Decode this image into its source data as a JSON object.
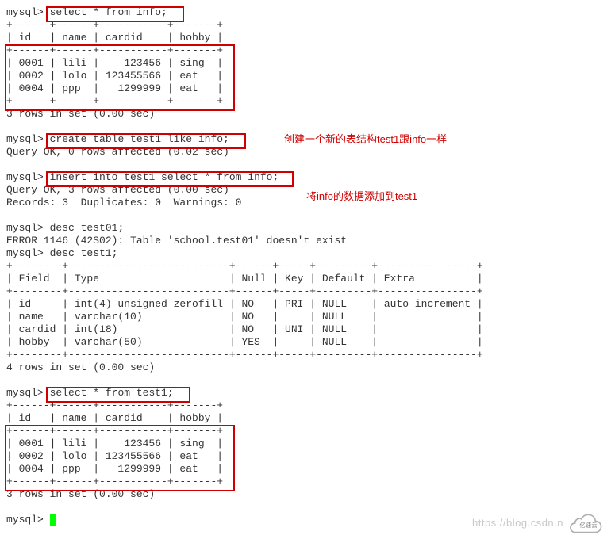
{
  "terminal": {
    "prompt": "mysql>",
    "stmt_select_info": "select * from info;",
    "hdr_sep": "+------+------+-----------+-------+",
    "hdr_cols": "| id   | name | cardid    | hobby |",
    "hdr_sep2": "+------+------+-----------+-------+",
    "row1": "| 0001 | lili |    123456 | sing  |",
    "row2": "| 0002 | lolo | 123455566 | eat   |",
    "row3": "| 0004 | ppp  |   1299999 | eat   |",
    "hdr_sep3": "+------+------+-----------+-------+",
    "rows3": "3 rows in set (0.00 sec)",
    "blank": "",
    "stmt_create": "create table test1 like info;",
    "create_ok": "Query OK, 0 rows affected (0.02 sec)",
    "stmt_insert": "insert into test1 select * from info;",
    "insert_ok": "Query OK, 3 rows affected (0.00 sec)",
    "records": "Records: 3  Duplicates: 0  Warnings: 0",
    "stmt_desc01": "desc test01;",
    "err01": "ERROR 1146 (42S02): Table 'school.test01' doesn't exist",
    "stmt_desc1": "desc test1;",
    "dsep": "+--------+--------------------------+------+-----+---------+----------------+",
    "dhdr": "| Field  | Type                     | Null | Key | Default | Extra          |",
    "dsep2": "+--------+--------------------------+------+-----+---------+----------------+",
    "d1": "| id     | int(4) unsigned zerofill | NO   | PRI | NULL    | auto_increment |",
    "d2": "| name   | varchar(10)              | NO   |     | NULL    |                |",
    "d3": "| cardid | int(18)                  | NO   | UNI | NULL    |                |",
    "d4": "| hobby  | varchar(50)              | YES  |     | NULL    |                |",
    "dsep3": "+--------+--------------------------+------+-----+---------+----------------+",
    "rows4": "4 rows in set (0.00 sec)",
    "stmt_select_t1": "select * from test1;",
    "t_sep": "+------+------+-----------+-------+",
    "t_cols": "| id   | name | cardid    | hobby |",
    "t_sep2": "+------+------+-----------+-------+",
    "t_row1": "| 0001 | lili |    123456 | sing  |",
    "t_row2": "| 0002 | lolo | 123455566 | eat   |",
    "t_row3": "| 0004 | ppp  |   1299999 | eat   |",
    "t_sep3": "+------+------+-----------+-------+",
    "rows3b": "3 rows in set (0.00 sec)"
  },
  "annotations": {
    "anno1": "创建一个新的表结构test1跟info一样",
    "anno2": "将info的数据添加到test1"
  },
  "watermark": "https://blog.csdn.n",
  "logo_text": "亿速云"
}
